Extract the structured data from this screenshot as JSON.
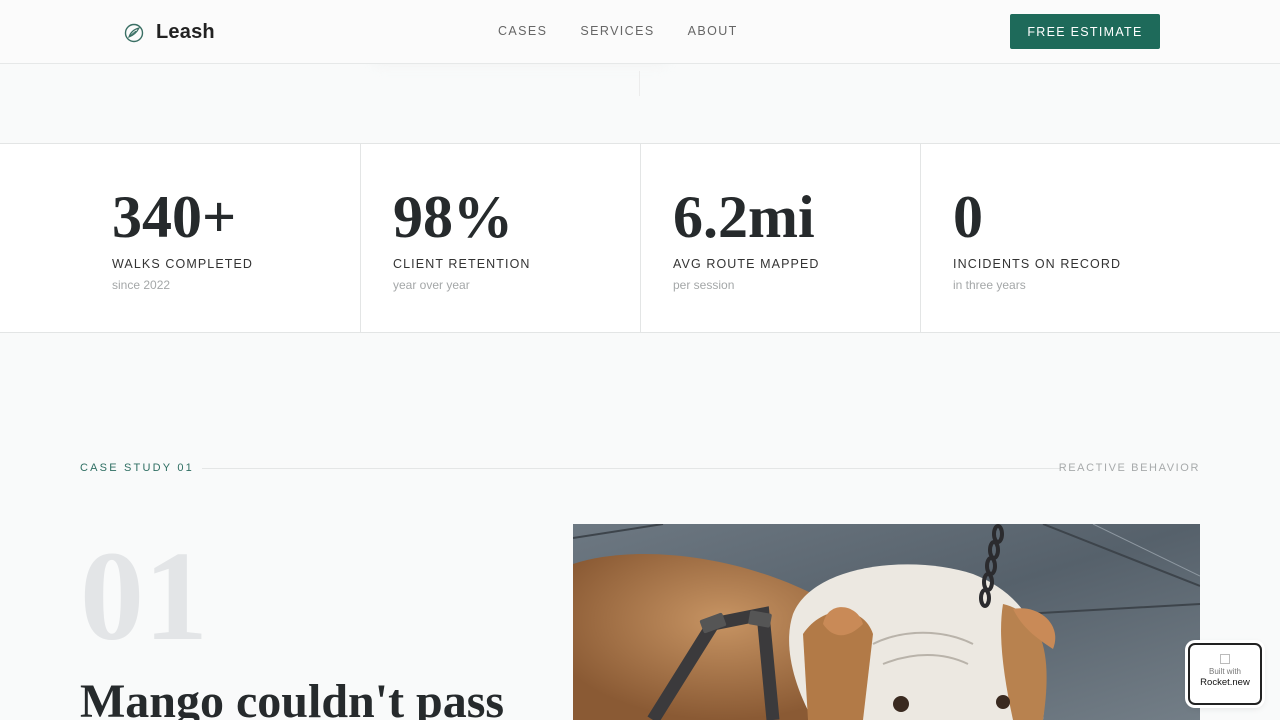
{
  "header": {
    "logo_text": "Leash",
    "logo_icon": "leaf-globe-icon",
    "nav": [
      "CASES",
      "SERVICES",
      "ABOUT"
    ],
    "cta_label": "FREE ESTIMATE",
    "brand_color": "#1e6a5a"
  },
  "stats": [
    {
      "value": "340+",
      "label": "WALKS COMPLETED",
      "sub": "since 2022"
    },
    {
      "value": "98%",
      "label": "CLIENT RETENTION",
      "sub": "year over year"
    },
    {
      "value": "6.2mi",
      "label": "AVG ROUTE MAPPED",
      "sub": "per session"
    },
    {
      "value": "0",
      "label": "INCIDENTS ON RECORD",
      "sub": "in three years"
    }
  ],
  "case_study": {
    "tag": "CASE STUDY 01",
    "category": "REACTIVE BEHAVIOR",
    "number": "01",
    "title": "Mango couldn't pass",
    "photo_subject": "bulldog-on-leash-photo"
  },
  "badge": {
    "built_with": "Built with",
    "brand": "Rocket.new"
  }
}
